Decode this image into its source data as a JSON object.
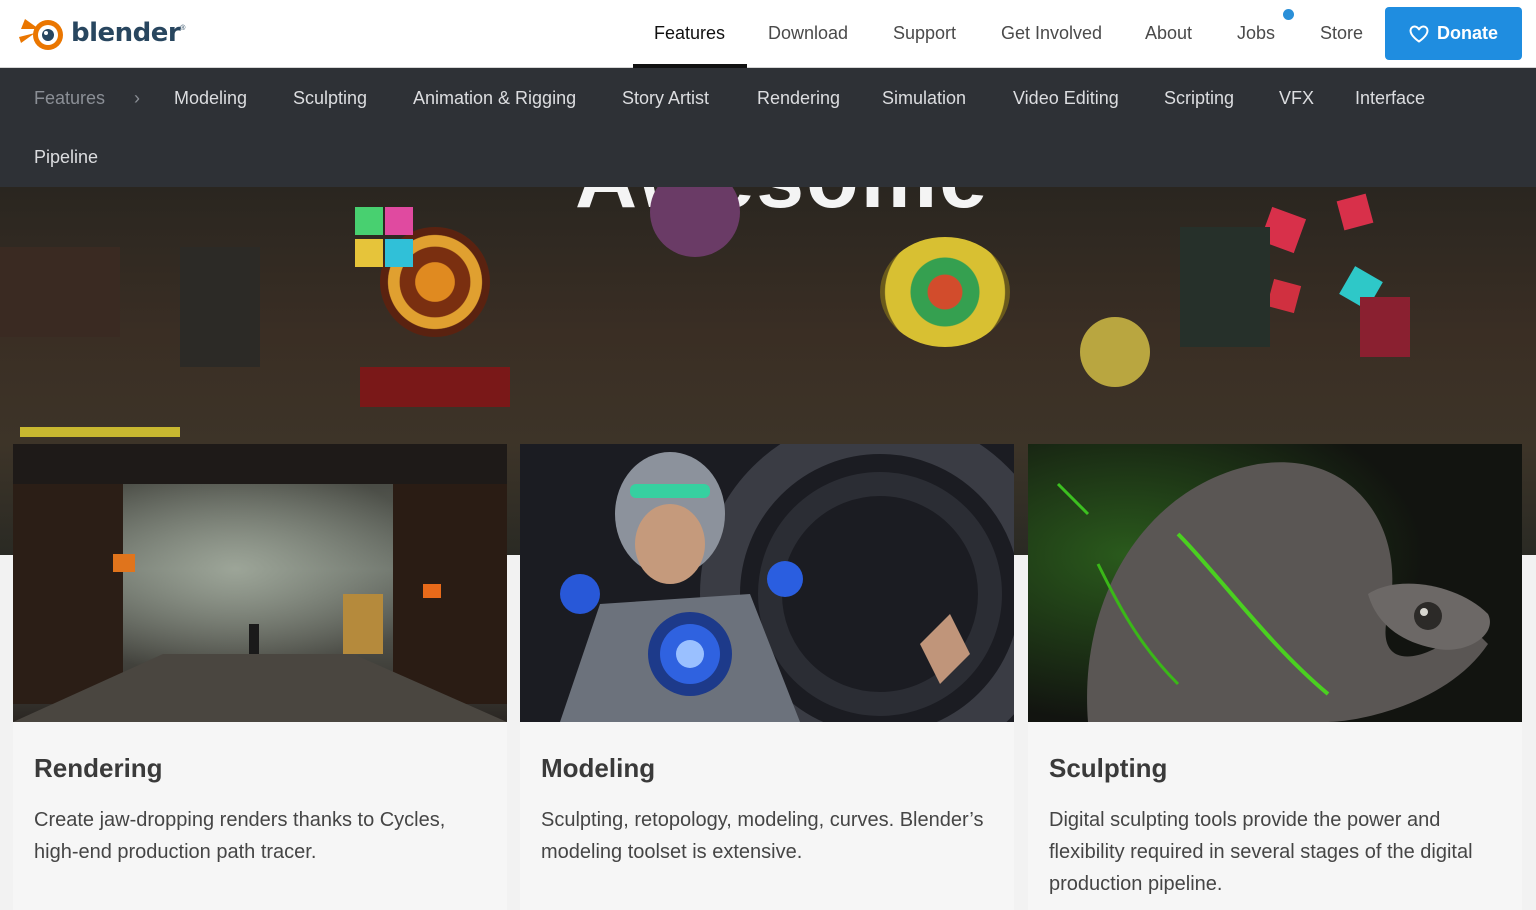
{
  "brand": {
    "name": "blender",
    "tm": "®"
  },
  "topnav": {
    "items": [
      "Features",
      "Download",
      "Support",
      "Get Involved",
      "About",
      "Jobs",
      "Store"
    ],
    "active": "Features",
    "donate": "Donate"
  },
  "subnav": {
    "breadcrumb": "Features",
    "items": [
      "Modeling",
      "Sculpting",
      "Animation & Rigging",
      "Story Artist",
      "Rendering",
      "Simulation",
      "Video Editing",
      "Scripting",
      "VFX",
      "Interface",
      "Pipeline"
    ]
  },
  "hero": {
    "title": "Awesome"
  },
  "cards": [
    {
      "title": "Rendering",
      "description": "Create jaw-dropping renders thanks to Cycles, high-end production path tracer."
    },
    {
      "title": "Modeling",
      "description": "Sculpting, retopology, modeling, curves. Blender’s modeling toolset is extensive."
    },
    {
      "title": "Sculpting",
      "description": "Digital sculpting tools provide the power and flexibility required in several stages of the digital production pipeline."
    }
  ],
  "colors": {
    "accent": "#1f8de0",
    "subnav_bg": "#2e3136",
    "logo_orange": "#ea7600",
    "logo_blue": "#28465f"
  }
}
